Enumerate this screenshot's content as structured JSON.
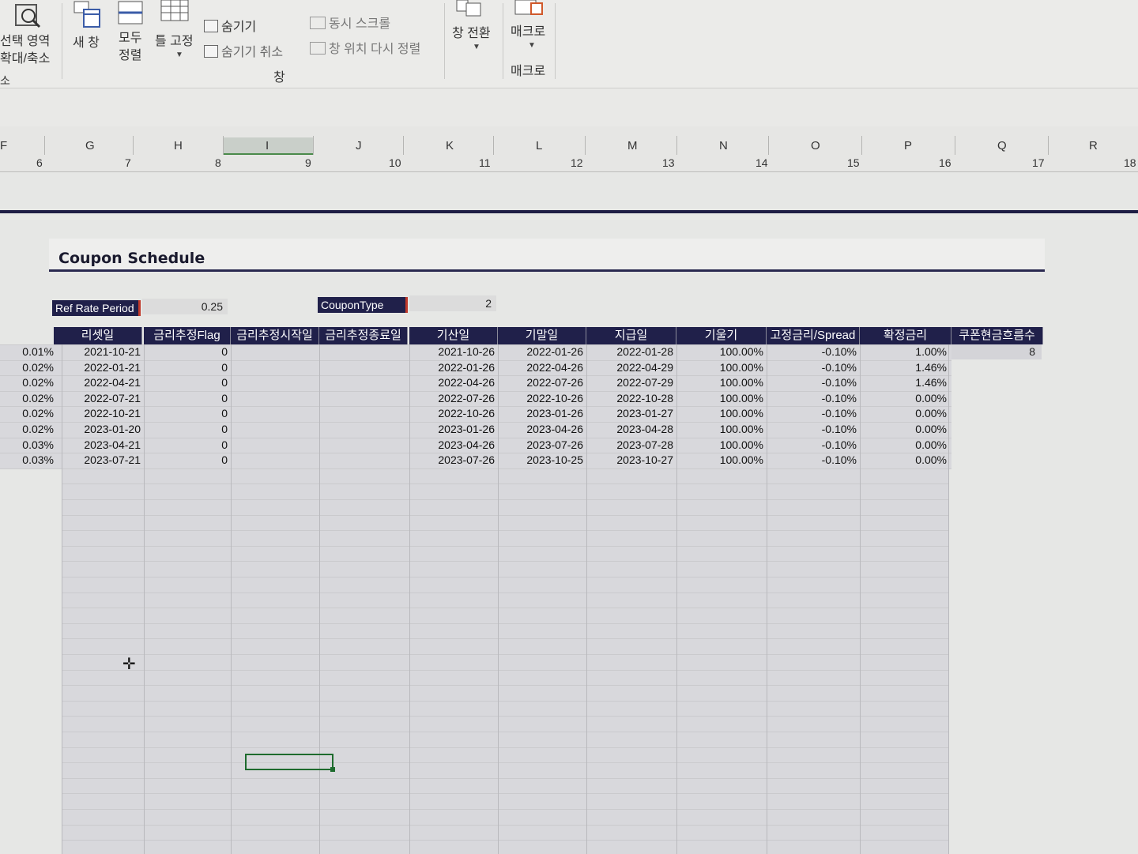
{
  "ribbon": {
    "zoom_selection": "선택 영역\n확대/축소",
    "new_window": "새 창",
    "arrange_all": "모두\n정렬",
    "freeze_panes": "틀 고정",
    "hide": "숨기기",
    "unhide": "숨기기 취소",
    "sync_scroll": "동시 스크롤",
    "reset_position": "창 위치 다시 정렬",
    "switch_windows": "창 전환",
    "macros": "매크로",
    "group_window": "창",
    "group_macros": "매크로",
    "cut_fragment": "소"
  },
  "columns": {
    "letters": [
      "F",
      "G",
      "H",
      "I",
      "J",
      "K",
      "L",
      "M",
      "N",
      "O",
      "P",
      "Q",
      "R"
    ],
    "numbers": [
      "6",
      "7",
      "8",
      "9",
      "10",
      "11",
      "12",
      "13",
      "14",
      "15",
      "16",
      "17",
      "18"
    ]
  },
  "sheet": {
    "title": "Coupon Schedule",
    "ref_rate_period_label": "Ref Rate Period",
    "ref_rate_period_value": "0.25",
    "coupon_type_label": "CouponType",
    "coupon_type_value": "2"
  },
  "table": {
    "headers": [
      "리셋일",
      "금리추정Flag",
      "금리추정시작일",
      "금리추정종료일",
      "기산일",
      "기말일",
      "지급일",
      "기울기",
      "고정금리/Spread",
      "확정금리",
      "쿠폰현금흐름수"
    ],
    "cashflow_count": "8",
    "rows": [
      {
        "rate": "0.01%",
        "reset": "2021-10-21",
        "flag": "0",
        "start": "2021-10-26",
        "end": "2022-01-26",
        "pay": "2022-01-28",
        "slope": "100.00%",
        "spread": "-0.10%",
        "fixed": "1.00%"
      },
      {
        "rate": "0.02%",
        "reset": "2022-01-21",
        "flag": "0",
        "start": "2022-01-26",
        "end": "2022-04-26",
        "pay": "2022-04-29",
        "slope": "100.00%",
        "spread": "-0.10%",
        "fixed": "1.46%"
      },
      {
        "rate": "0.02%",
        "reset": "2022-04-21",
        "flag": "0",
        "start": "2022-04-26",
        "end": "2022-07-26",
        "pay": "2022-07-29",
        "slope": "100.00%",
        "spread": "-0.10%",
        "fixed": "1.46%"
      },
      {
        "rate": "0.02%",
        "reset": "2022-07-21",
        "flag": "0",
        "start": "2022-07-26",
        "end": "2022-10-26",
        "pay": "2022-10-28",
        "slope": "100.00%",
        "spread": "-0.10%",
        "fixed": "0.00%"
      },
      {
        "rate": "0.02%",
        "reset": "2022-10-21",
        "flag": "0",
        "start": "2022-10-26",
        "end": "2023-01-26",
        "pay": "2023-01-27",
        "slope": "100.00%",
        "spread": "-0.10%",
        "fixed": "0.00%"
      },
      {
        "rate": "0.02%",
        "reset": "2023-01-20",
        "flag": "0",
        "start": "2023-01-26",
        "end": "2023-04-26",
        "pay": "2023-04-28",
        "slope": "100.00%",
        "spread": "-0.10%",
        "fixed": "0.00%"
      },
      {
        "rate": "0.03%",
        "reset": "2023-04-21",
        "flag": "0",
        "start": "2023-04-26",
        "end": "2023-07-26",
        "pay": "2023-07-28",
        "slope": "100.00%",
        "spread": "-0.10%",
        "fixed": "0.00%"
      },
      {
        "rate": "0.03%",
        "reset": "2023-07-21",
        "flag": "0",
        "start": "2023-07-26",
        "end": "2023-10-25",
        "pay": "2023-10-27",
        "slope": "100.00%",
        "spread": "-0.10%",
        "fixed": "0.00%"
      }
    ]
  }
}
